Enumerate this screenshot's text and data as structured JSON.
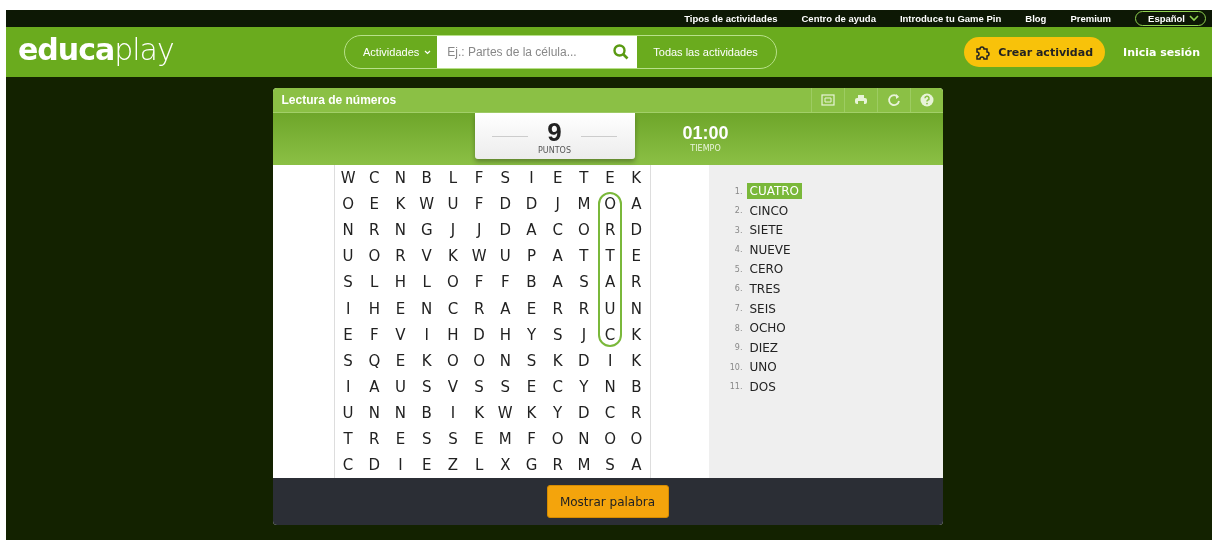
{
  "top_links": [
    "Tipos de actividades",
    "Centro de ayuda",
    "Introduce tu Game Pin",
    "Blog",
    "Premium"
  ],
  "language": {
    "label": "Español"
  },
  "header": {
    "logo_left": "educa",
    "logo_right": "play",
    "category": "Actividades",
    "search": {
      "placeholder": "Ej.: Partes de la célula..."
    },
    "all_link": "Todas las actividades",
    "create_button": "Crear actividad",
    "login": "Inicia sesión"
  },
  "game": {
    "title": "Lectura de números",
    "score": "9",
    "score_label": "PUNTOS",
    "time": "01:00",
    "time_label": "TIEMPO",
    "grid": [
      [
        {
          "letter": "W",
          "circled": false
        },
        {
          "letter": "C",
          "circled": false
        },
        {
          "letter": "N",
          "circled": false
        },
        {
          "letter": "B",
          "circled": false
        },
        {
          "letter": "L",
          "circled": false
        },
        {
          "letter": "F",
          "circled": false
        },
        {
          "letter": "S",
          "circled": false
        },
        {
          "letter": "I",
          "circled": false
        },
        {
          "letter": "E",
          "circled": false
        },
        {
          "letter": "T",
          "circled": false
        },
        {
          "letter": "E",
          "circled": false
        },
        {
          "letter": "K",
          "circled": false
        }
      ],
      [
        {
          "letter": "O",
          "circled": false
        },
        {
          "letter": "E",
          "circled": false
        },
        {
          "letter": "K",
          "circled": false
        },
        {
          "letter": "W",
          "circled": false
        },
        {
          "letter": "U",
          "circled": false
        },
        {
          "letter": "F",
          "circled": false
        },
        {
          "letter": "D",
          "circled": false
        },
        {
          "letter": "D",
          "circled": false
        },
        {
          "letter": "J",
          "circled": false
        },
        {
          "letter": "M",
          "circled": false
        },
        {
          "letter": "O",
          "circled": true
        },
        {
          "letter": "A",
          "circled": false
        }
      ],
      [
        {
          "letter": "N",
          "circled": false
        },
        {
          "letter": "R",
          "circled": false
        },
        {
          "letter": "N",
          "circled": false
        },
        {
          "letter": "G",
          "circled": false
        },
        {
          "letter": "J",
          "circled": false
        },
        {
          "letter": "J",
          "circled": false
        },
        {
          "letter": "D",
          "circled": false
        },
        {
          "letter": "A",
          "circled": false
        },
        {
          "letter": "C",
          "circled": false
        },
        {
          "letter": "O",
          "circled": false
        },
        {
          "letter": "R",
          "circled": true
        },
        {
          "letter": "D",
          "circled": false
        }
      ],
      [
        {
          "letter": "U",
          "circled": false
        },
        {
          "letter": "O",
          "circled": false
        },
        {
          "letter": "R",
          "circled": false
        },
        {
          "letter": "V",
          "circled": false
        },
        {
          "letter": "K",
          "circled": false
        },
        {
          "letter": "W",
          "circled": false
        },
        {
          "letter": "U",
          "circled": false
        },
        {
          "letter": "P",
          "circled": false
        },
        {
          "letter": "A",
          "circled": false
        },
        {
          "letter": "T",
          "circled": false
        },
        {
          "letter": "T",
          "circled": true
        },
        {
          "letter": "E",
          "circled": false
        }
      ],
      [
        {
          "letter": "S",
          "circled": false
        },
        {
          "letter": "L",
          "circled": false
        },
        {
          "letter": "H",
          "circled": false
        },
        {
          "letter": "L",
          "circled": false
        },
        {
          "letter": "O",
          "circled": false
        },
        {
          "letter": "F",
          "circled": false
        },
        {
          "letter": "F",
          "circled": false
        },
        {
          "letter": "B",
          "circled": false
        },
        {
          "letter": "A",
          "circled": false
        },
        {
          "letter": "S",
          "circled": false
        },
        {
          "letter": "A",
          "circled": true
        },
        {
          "letter": "R",
          "circled": false
        }
      ],
      [
        {
          "letter": "I",
          "circled": false
        },
        {
          "letter": "H",
          "circled": false
        },
        {
          "letter": "E",
          "circled": false
        },
        {
          "letter": "N",
          "circled": false
        },
        {
          "letter": "C",
          "circled": false
        },
        {
          "letter": "R",
          "circled": false
        },
        {
          "letter": "A",
          "circled": false
        },
        {
          "letter": "E",
          "circled": false
        },
        {
          "letter": "R",
          "circled": false
        },
        {
          "letter": "R",
          "circled": false
        },
        {
          "letter": "U",
          "circled": true
        },
        {
          "letter": "N",
          "circled": false
        }
      ],
      [
        {
          "letter": "E",
          "circled": false
        },
        {
          "letter": "F",
          "circled": false
        },
        {
          "letter": "V",
          "circled": false
        },
        {
          "letter": "I",
          "circled": false
        },
        {
          "letter": "H",
          "circled": false
        },
        {
          "letter": "D",
          "circled": false
        },
        {
          "letter": "H",
          "circled": false
        },
        {
          "letter": "Y",
          "circled": false
        },
        {
          "letter": "S",
          "circled": false
        },
        {
          "letter": "J",
          "circled": false
        },
        {
          "letter": "C",
          "circled": true
        },
        {
          "letter": "K",
          "circled": false
        }
      ],
      [
        {
          "letter": "S",
          "circled": false
        },
        {
          "letter": "Q",
          "circled": false
        },
        {
          "letter": "E",
          "circled": false
        },
        {
          "letter": "K",
          "circled": false
        },
        {
          "letter": "O",
          "circled": false
        },
        {
          "letter": "O",
          "circled": false
        },
        {
          "letter": "N",
          "circled": false
        },
        {
          "letter": "S",
          "circled": false
        },
        {
          "letter": "K",
          "circled": false
        },
        {
          "letter": "D",
          "circled": false
        },
        {
          "letter": "I",
          "circled": false
        },
        {
          "letter": "K",
          "circled": false
        }
      ],
      [
        {
          "letter": "I",
          "circled": false
        },
        {
          "letter": "A",
          "circled": false
        },
        {
          "letter": "U",
          "circled": false
        },
        {
          "letter": "S",
          "circled": false
        },
        {
          "letter": "V",
          "circled": false
        },
        {
          "letter": "S",
          "circled": false
        },
        {
          "letter": "S",
          "circled": false
        },
        {
          "letter": "E",
          "circled": false
        },
        {
          "letter": "C",
          "circled": false
        },
        {
          "letter": "Y",
          "circled": false
        },
        {
          "letter": "N",
          "circled": false
        },
        {
          "letter": "B",
          "circled": false
        }
      ],
      [
        {
          "letter": "U",
          "circled": false
        },
        {
          "letter": "N",
          "circled": false
        },
        {
          "letter": "N",
          "circled": false
        },
        {
          "letter": "B",
          "circled": false
        },
        {
          "letter": "I",
          "circled": false
        },
        {
          "letter": "K",
          "circled": false
        },
        {
          "letter": "W",
          "circled": false
        },
        {
          "letter": "K",
          "circled": false
        },
        {
          "letter": "Y",
          "circled": false
        },
        {
          "letter": "D",
          "circled": false
        },
        {
          "letter": "C",
          "circled": false
        },
        {
          "letter": "R",
          "circled": false
        }
      ],
      [
        {
          "letter": "T",
          "circled": false
        },
        {
          "letter": "R",
          "circled": false
        },
        {
          "letter": "E",
          "circled": false
        },
        {
          "letter": "S",
          "circled": false
        },
        {
          "letter": "S",
          "circled": false
        },
        {
          "letter": "E",
          "circled": false
        },
        {
          "letter": "M",
          "circled": false
        },
        {
          "letter": "F",
          "circled": false
        },
        {
          "letter": "O",
          "circled": false
        },
        {
          "letter": "N",
          "circled": false
        },
        {
          "letter": "O",
          "circled": false
        },
        {
          "letter": "O",
          "circled": false
        }
      ],
      [
        {
          "letter": "C",
          "circled": false
        },
        {
          "letter": "D",
          "circled": false
        },
        {
          "letter": "I",
          "circled": false
        },
        {
          "letter": "E",
          "circled": false
        },
        {
          "letter": "Z",
          "circled": false
        },
        {
          "letter": "L",
          "circled": false
        },
        {
          "letter": "X",
          "circled": false
        },
        {
          "letter": "G",
          "circled": false
        },
        {
          "letter": "R",
          "circled": false
        },
        {
          "letter": "M",
          "circled": false
        },
        {
          "letter": "S",
          "circled": false
        },
        {
          "letter": "A",
          "circled": false
        }
      ]
    ],
    "words": [
      {
        "number": "1.",
        "word": "CUATRO",
        "found": true
      },
      {
        "number": "2.",
        "word": "CINCO",
        "found": false
      },
      {
        "number": "3.",
        "word": "SIETE",
        "found": false
      },
      {
        "number": "4.",
        "word": "NUEVE",
        "found": false
      },
      {
        "number": "5.",
        "word": "CERO",
        "found": false
      },
      {
        "number": "6.",
        "word": "TRES",
        "found": false
      },
      {
        "number": "7.",
        "word": "SEIS",
        "found": false
      },
      {
        "number": "8.",
        "word": "OCHO",
        "found": false
      },
      {
        "number": "9.",
        "word": "DIEZ",
        "found": false
      },
      {
        "number": "10.",
        "word": "UNO",
        "found": false
      },
      {
        "number": "11.",
        "word": "DOS",
        "found": false
      }
    ],
    "show_word_button": "Mostrar palabra"
  }
}
